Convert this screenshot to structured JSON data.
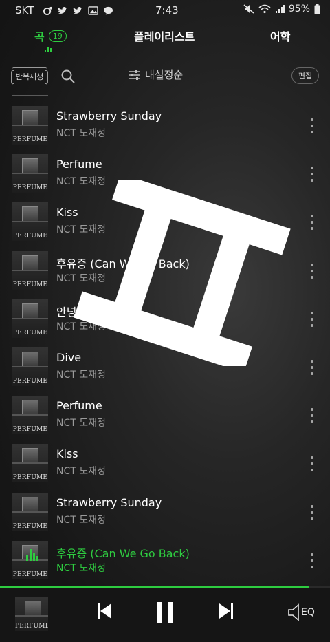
{
  "status_bar": {
    "carrier": "SKT",
    "time": "7:43",
    "battery": "95%"
  },
  "tabs": [
    {
      "label": "곡",
      "count": "19",
      "active": true
    },
    {
      "label": "플레이리스트"
    },
    {
      "label": "어학"
    }
  ],
  "toolbar": {
    "repeat_label": "반복재생",
    "sort_label": "내설정순",
    "edit_label": "편집"
  },
  "album": {
    "label": "PERFUME"
  },
  "songs": [
    {
      "title": "Strawberry Sunday",
      "artist": "NCT 도재정"
    },
    {
      "title": "Perfume",
      "artist": "NCT 도재정"
    },
    {
      "title": "Kiss",
      "artist": "NCT 도재정"
    },
    {
      "title": "후유증 (Can We Go Back)",
      "artist": "NCT 도재정"
    },
    {
      "title": "안녕",
      "artist": "NCT 도재정"
    },
    {
      "title": "Dive",
      "artist": "NCT 도재정"
    },
    {
      "title": "Perfume",
      "artist": "NCT 도재정"
    },
    {
      "title": "Kiss",
      "artist": "NCT 도재정"
    },
    {
      "title": "Strawberry Sunday",
      "artist": "NCT 도재정"
    },
    {
      "title": "후유증 (Can We Go Back)",
      "artist": "NCT 도재정",
      "playing": true
    }
  ],
  "player": {
    "eq_label": "EQ",
    "progress": 0.935
  },
  "colors": {
    "accent": "#2ecc40",
    "background": "#171717"
  },
  "icons": {
    "search": "search-icon",
    "sort": "sliders-icon",
    "more": "more-vertical-icon",
    "prev": "skip-previous-icon",
    "pause": "pause-icon",
    "next": "skip-next-icon",
    "eq": "equalizer-icon"
  }
}
